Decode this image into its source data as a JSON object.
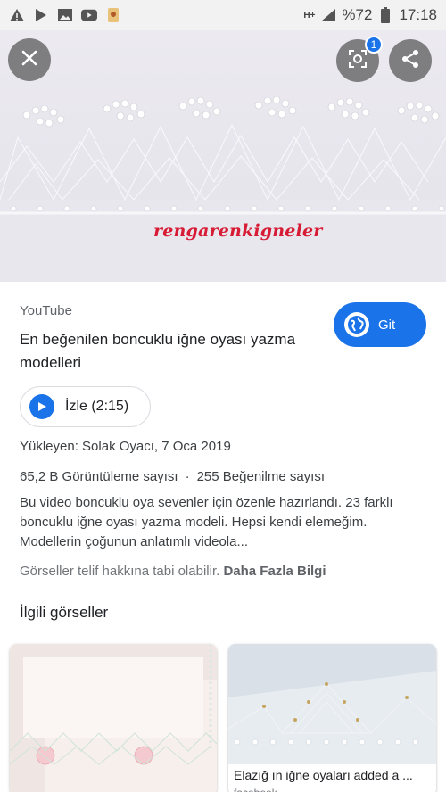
{
  "status_bar": {
    "network": "H+",
    "battery": "%72",
    "time": "17:18"
  },
  "hero": {
    "watermark": "rengarenkigneler",
    "lens_badge": "1"
  },
  "result": {
    "source": "YouTube",
    "title": "En beğenilen boncuklu iğne oyası yazma modelleri",
    "visit_label": "Git",
    "watch_label": "İzle (2:15)",
    "uploader": "Yükleyen: Solak Oyacı, 7 Oca 2019",
    "views": "65,2 B Görüntüleme sayısı",
    "separator": "·",
    "likes": "255 Beğenilme sayısı",
    "description": "Bu video boncuklu oya sevenler için özenle hazırlandı. 23 farklı boncuklu iğne oyası yazma modeli. Hepsi kendi elemeğim. Modellerin çoğunun anlatımlı videola...",
    "copyright": "Görseller telif hakkına tabi olabilir.",
    "more_info": "Daha Fazla Bilgi"
  },
  "related": {
    "title": "İlgili görseller",
    "cards": [
      {
        "caption": "",
        "sub": ""
      },
      {
        "caption": "Elazığ ın iğne oyaları added a ...",
        "sub": "facebook"
      }
    ]
  },
  "colors": {
    "accent": "#1a73e8",
    "watermark": "#d81b35"
  }
}
